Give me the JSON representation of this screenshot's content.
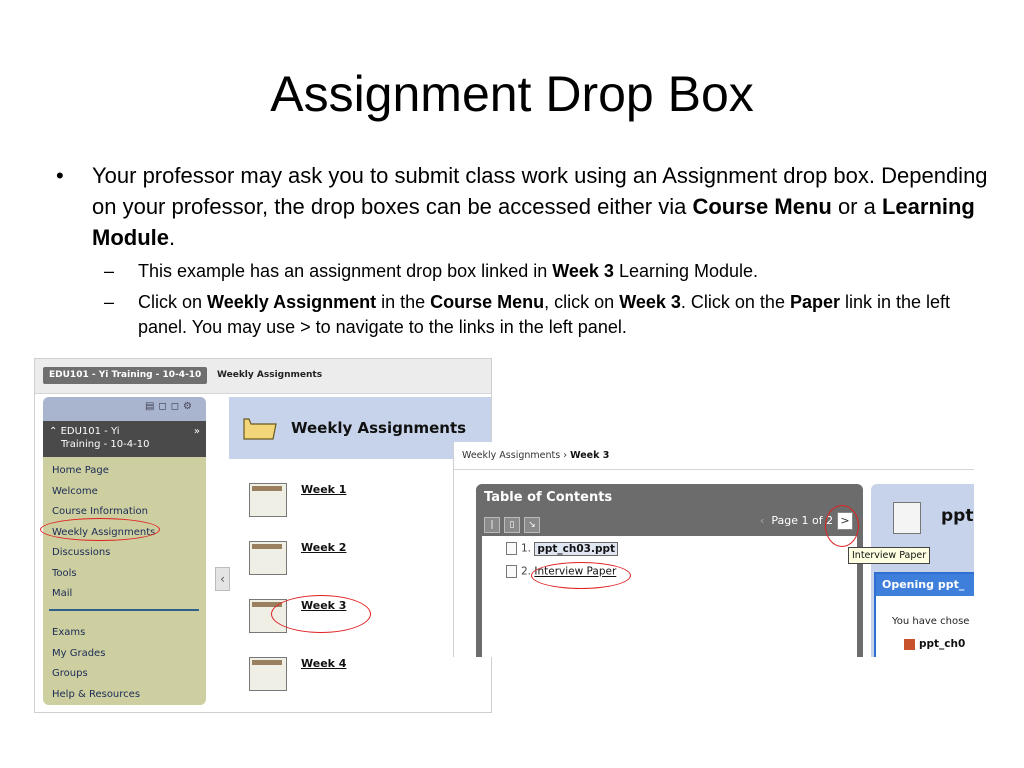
{
  "slide": {
    "title": "Assignment Drop Box",
    "bullet1": {
      "part1": "Your professor may ask you to submit class work using an Assignment drop box.  Depending on your professor, the drop boxes can be accessed either via ",
      "bold1": "Course Menu",
      "part2": " or a ",
      "bold2": "Learning Module",
      "part3": "."
    },
    "sub1": {
      "part1": "This example has an assignment drop box linked in ",
      "bold1": "Week 3",
      "part2": " Learning Module."
    },
    "sub2": {
      "part1": "Click on ",
      "bold1": "Weekly Assignment",
      "part2": " in the ",
      "bold2": "Course Menu",
      "part3": ", click on ",
      "bold3": "Week 3",
      "part4": ".  Click on the ",
      "bold4": "Paper",
      "part5": " link in the left panel. You may use > to navigate to the links in the left panel."
    },
    "bullet_glyph": "•",
    "dash_glyph": "–"
  },
  "screenshot1": {
    "course_crumb": "EDU101 - Yi Training - 10-4-10",
    "page_crumb": "Weekly Assignments",
    "nav_title_line1": "EDU101 - Yi",
    "nav_title_line2": "Training - 10-4-10",
    "nav_items": [
      "Home Page",
      "Welcome",
      "Course Information",
      "Weekly Assignments",
      "Discussions",
      "Tools",
      "Mail"
    ],
    "nav_items2": [
      "Exams",
      "My Grades",
      "Groups",
      "Help & Resources"
    ],
    "content_title": "Weekly Assignments",
    "weeks": [
      "Week 1",
      "Week 2",
      "Week 3",
      "Week 4"
    ]
  },
  "screenshot2": {
    "crumb_parent": "Weekly Assignments",
    "crumb_sep": "›",
    "crumb_current": "Week 3",
    "toc_title": "Table of Contents",
    "page_indicator": "Page 1 of 2",
    "next_glyph": ">",
    "items": [
      {
        "number": "1.",
        "label": "ppt_ch03.ppt"
      },
      {
        "number": "2.",
        "label": "Interview Paper"
      }
    ],
    "tooltip": "Interview Paper",
    "right_title": "ppt",
    "dialog_title": "Opening ppt_",
    "dialog_text": "You have chose",
    "dialog_file": "ppt_ch0"
  },
  "colors": {
    "annotation_red": "#e02020",
    "nav_bg": "#cdcfa0",
    "header_blue": "#c6d3ea"
  }
}
